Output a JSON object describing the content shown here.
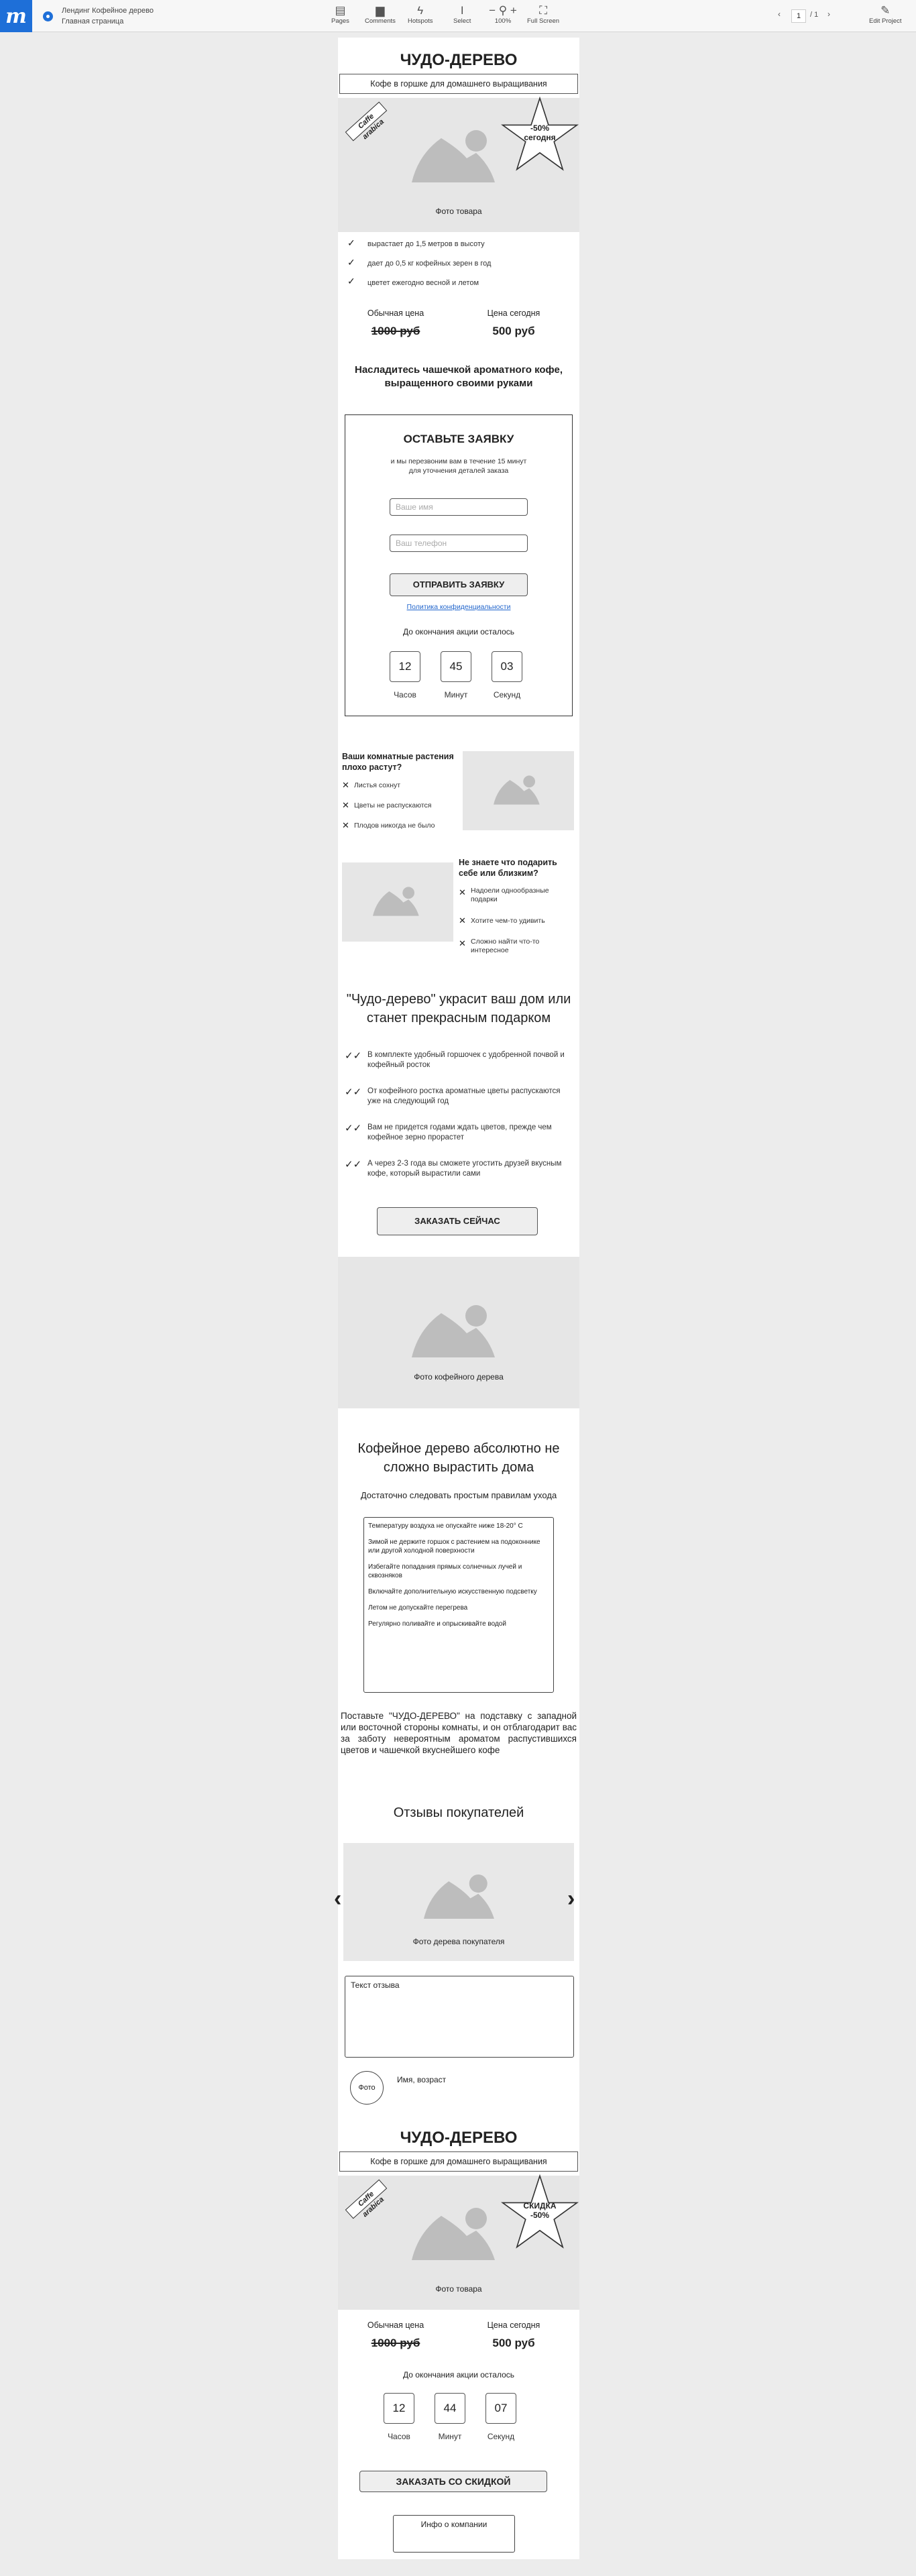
{
  "topbar": {
    "logo": "m",
    "project": "Лендинг Кофейное дерево",
    "page": "Главная страница",
    "tools": {
      "pages": "Pages",
      "comments": "Comments",
      "hotspots": "Hotspots",
      "select": "Select",
      "zoom": "100%",
      "fullscreen": "Full Screen",
      "edit": "Edit Project"
    },
    "pager": {
      "current": "1",
      "total": "/ 1"
    }
  },
  "hero": {
    "title": "ЧУДО-ДЕРЕВО",
    "subtitle": "Кофе в горшке для домашнего выращивания",
    "stamp": "Caffe arabica",
    "star": "-50%\nсегодня",
    "photo": "Фото товара"
  },
  "features": [
    "вырастает до 1,5 метров в высоту",
    "дает до 0,5 кг кофейных зерен в год",
    "цветет ежегодно весной и летом"
  ],
  "price": {
    "old_label": "Обычная цена",
    "old": "1000 руб",
    "new_label": "Цена сегодня",
    "new": "500 руб"
  },
  "tagline": "Насладитесь чашечкой ароматного кофе, выращенного своими руками",
  "form": {
    "title": "ОСТАВЬТЕ ЗАЯВКУ",
    "desc": "и мы перезвоним вам в течение 15 минут\nдля уточнения деталей заказа",
    "name_ph": "Ваше имя",
    "phone_ph": "Ваш телефон",
    "submit": "ОТПРАВИТЬ ЗАЯВКУ",
    "policy": "Политика конфиденциальности",
    "countdown": "До окончания акции осталось",
    "timer": {
      "h": "12",
      "m": "45",
      "s": "03"
    },
    "labels": {
      "h": "Часов",
      "m": "Минут",
      "s": "Секунд"
    }
  },
  "problems1": {
    "title": "Ваши комнатные растения плохо растут?",
    "items": [
      "Листья сохнут",
      "Цветы не распускаются",
      "Плодов никогда не было"
    ]
  },
  "problems2": {
    "title": "Не знаете что подарить себе или близким?",
    "items": [
      "Надоели однообразные подарки",
      "Хотите чем-то удивить",
      "Сложно найти что-то интересное"
    ]
  },
  "benefits": {
    "title": "\"Чудо-дерево\" украсит ваш дом или станет прекрасным подарком",
    "items": [
      "В комплекте удобный горшочек с удобренной почвой и кофейный росток",
      "От кофейного ростка ароматные цветы распускаются уже на следующий год",
      "Вам не придется годами ждать цветов, прежде чем кофейное зерно прорастет",
      "А через 2-3 года вы сможете угостить друзей вкусным кофе, который вырастили сами"
    ],
    "cta": "ЗАКАЗАТЬ СЕЙЧАС"
  },
  "tree_photo": "Фото кофейного дерева",
  "care": {
    "title": "Кофейное дерево абсолютно не сложно вырастить дома",
    "subtitle": "Достаточно следовать простым правилам ухода",
    "rules": [
      "Температуру воздуха не опускайте ниже 18-20° С",
      "Зимой не держите горшок с растением на подоконнике или другой холодной поверхности",
      "Избегайте попадания прямых солнечных лучей и сквозняков",
      "Включайте дополнительную искусственную подсветку",
      "Летом не допускайте перегрева",
      "Регулярно поливайте и опрыскивайте водой"
    ],
    "text": "Поставьте \"ЧУДО-ДЕРЕВО\" на подставку с западной или восточной стороны комнаты, и он отблагодарит вас за заботу невероятным ароматом распустившихся цветов и чашечкой вкуснейшего кофе"
  },
  "reviews": {
    "title": "Отзывы покупателей",
    "photo": "Фото дерева покупателя",
    "text": "Текст отзыва",
    "avatar": "Фото",
    "author": "Имя, возраст",
    "prev": "‹",
    "next": "›"
  },
  "footer": {
    "title": "ЧУДО-ДЕРЕВО",
    "subtitle": "Кофе в горшке для домашнего выращивания",
    "stamp": "Caffe arabica",
    "star": "СКИДКА\n-50%",
    "photo": "Фото товара",
    "old_label": "Обычная цена",
    "old": "1000 руб",
    "new_label": "Цена сегодня",
    "new": "500 руб",
    "countdown": "До окончания акции осталось",
    "timer": {
      "h": "12",
      "m": "44",
      "s": "07"
    },
    "labels": {
      "h": "Часов",
      "m": "Минут",
      "s": "Секунд"
    },
    "cta": "ЗАКАЗАТЬ СО СКИДКОЙ",
    "company": "Инфо о компании"
  }
}
